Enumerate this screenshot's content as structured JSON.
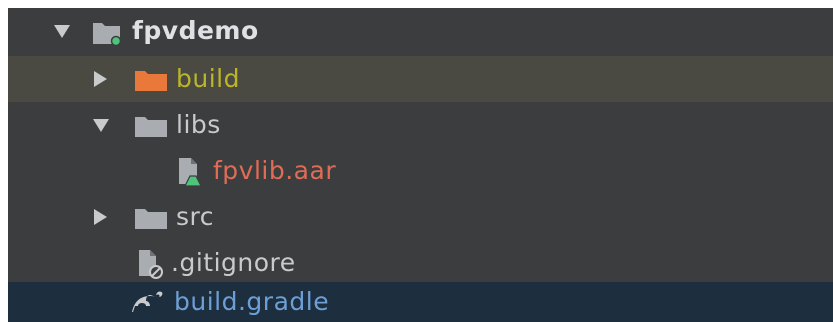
{
  "tree": {
    "items": [
      {
        "label": "fpvdemo",
        "icon": "module-folder-icon",
        "expanded": true,
        "color": "#dfe1e5",
        "bold": true
      },
      {
        "label": "build",
        "icon": "folder-icon",
        "expanded": false,
        "color": "#bbb529",
        "icon_color": "#e8793b"
      },
      {
        "label": "libs",
        "icon": "folder-icon",
        "expanded": true,
        "color": "#c8cacc",
        "icon_color": "#a9adb2"
      },
      {
        "label": "fpvlib.aar",
        "icon": "library-file-icon",
        "color": "#e06c55"
      },
      {
        "label": "src",
        "icon": "folder-icon",
        "expanded": false,
        "color": "#c8cacc",
        "icon_color": "#a9adb2"
      },
      {
        "label": ".gitignore",
        "icon": "ignore-file-icon",
        "color": "#c8cacc"
      },
      {
        "label": "build.gradle",
        "icon": "gradle-icon",
        "color": "#6d9fd6"
      }
    ]
  }
}
